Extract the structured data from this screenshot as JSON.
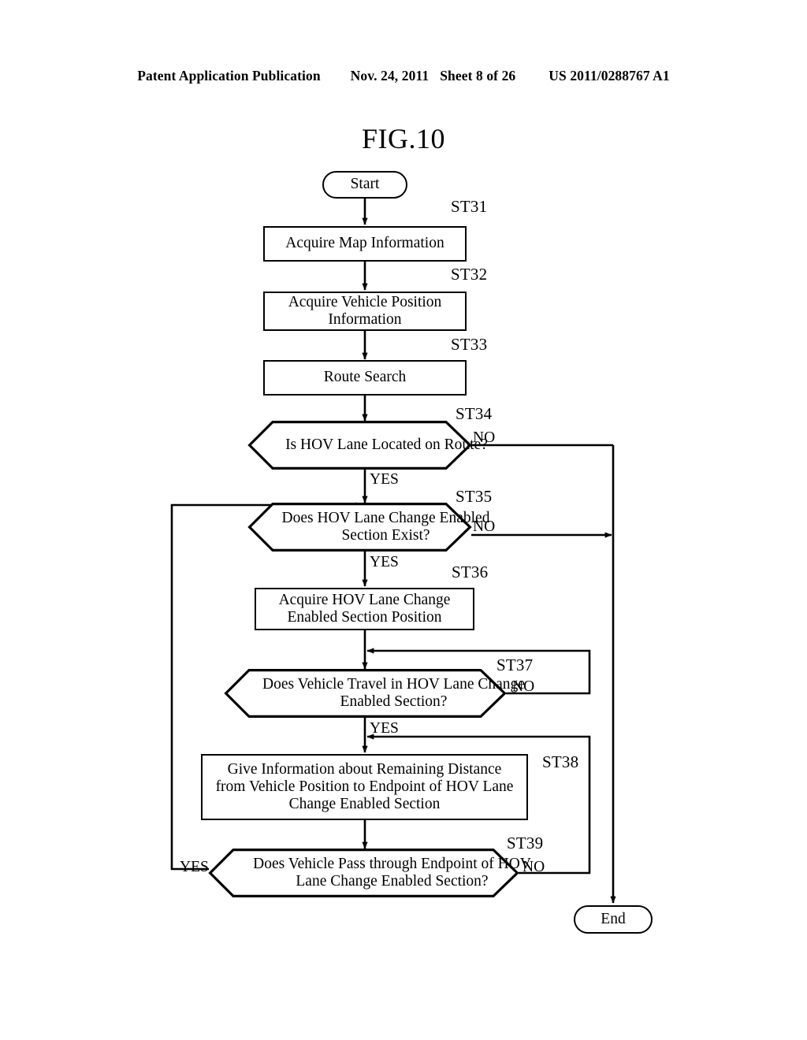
{
  "header": {
    "publication": "Patent Application Publication",
    "date": "Nov. 24, 2011",
    "sheet": "Sheet 8 of 26",
    "patent_number": "US 2011/0288767 A1"
  },
  "figure": {
    "title": "FIG.10"
  },
  "flowchart": {
    "start_label": "Start",
    "end_label": "End",
    "nodes": [
      {
        "id": "ST31",
        "tag": "ST31",
        "type": "process",
        "text": "Acquire Map Information"
      },
      {
        "id": "ST32",
        "tag": "ST32",
        "type": "process",
        "text": "Acquire Vehicle Position Information"
      },
      {
        "id": "ST33",
        "tag": "ST33",
        "type": "process",
        "text": "Route Search"
      },
      {
        "id": "ST34",
        "tag": "ST34",
        "type": "decision",
        "text": "Is HOV Lane Located on Route?"
      },
      {
        "id": "ST35",
        "tag": "ST35",
        "type": "decision",
        "text": "Does HOV Lane Change Enabled Section Exist?"
      },
      {
        "id": "ST36",
        "tag": "ST36",
        "type": "process",
        "text": "Acquire HOV Lane Change Enabled Section Position"
      },
      {
        "id": "ST37",
        "tag": "ST37",
        "type": "decision",
        "text": "Does Vehicle Travel in HOV Lane Change Enabled Section?"
      },
      {
        "id": "ST38",
        "tag": "ST38",
        "type": "process",
        "text": "Give Information about Remaining Distance from Vehicle Position to Endpoint of HOV Lane Change Enabled Section"
      },
      {
        "id": "ST39",
        "tag": "ST39",
        "type": "decision",
        "text": "Does Vehicle Pass through Endpoint of HOV Lane Change Enabled Section?"
      }
    ],
    "branch_labels": {
      "st34_no": "NO",
      "st34_yes": "YES",
      "st35_no": "NO",
      "st35_yes": "YES",
      "st37_no": "NO",
      "st37_yes": "YES",
      "st39_no": "NO",
      "st39_yes": "YES"
    }
  },
  "colors": {
    "ink": "#000000",
    "paper": "#ffffff"
  }
}
